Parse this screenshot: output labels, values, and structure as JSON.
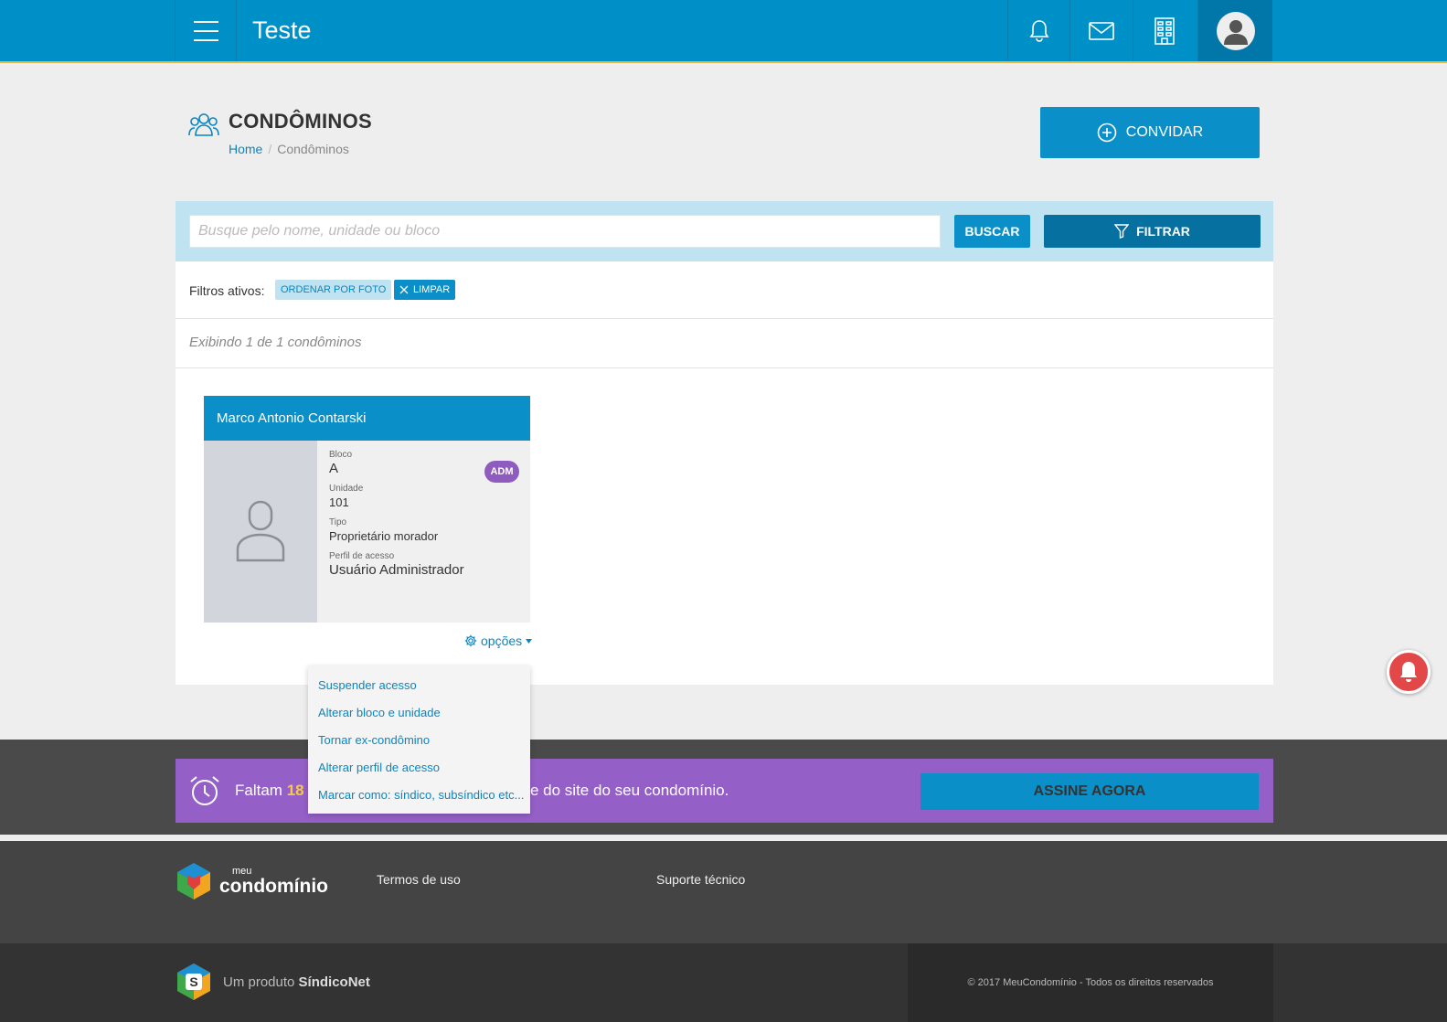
{
  "header": {
    "app_title": "Teste",
    "icons": [
      "menu-icon",
      "bell-icon",
      "mail-icon",
      "building-icon",
      "user-avatar-icon"
    ]
  },
  "page": {
    "title": "CONDÔMINOS",
    "breadcrumb": {
      "home": "Home",
      "separator": "/",
      "current": "Condôminos"
    },
    "invite_label": "CONVIDAR"
  },
  "search": {
    "placeholder": "Busque pelo nome, unidade ou bloco",
    "search_label": "BUSCAR",
    "filter_label": "FILTRAR"
  },
  "filters": {
    "label": "Filtros ativos:",
    "active_chip": "ORDENAR POR FOTO",
    "clear_label": "LIMPAR"
  },
  "results": {
    "count_text": "Exibindo 1 de 1 condôminos"
  },
  "card": {
    "name": "Marco Antonio Contarski",
    "badge": "ADM",
    "fields": {
      "bloco_label": "Bloco",
      "bloco_value": "A",
      "unidade_label": "Unidade",
      "unidade_value": "101",
      "tipo_label": "Tipo",
      "tipo_value": "Proprietário morador",
      "perfil_label": "Perfil de acesso",
      "perfil_value": "Usuário Administrador"
    },
    "options_label": "opções"
  },
  "dropdown": {
    "items": [
      "Suspender acesso",
      "Alterar bloco e unidade",
      "Tornar ex-condômino",
      "Alterar perfil de acesso",
      "Marcar como: síndico, subsíndico etc..."
    ]
  },
  "promo": {
    "text_start": "Faltam",
    "days": "18",
    "text_end": "e do site do seu condomínio.",
    "cta_label": "ASSINE AGORA"
  },
  "footer": {
    "brand_small": "meu",
    "brand_large": "condomínio",
    "links": [
      "Termos de uso",
      "Suporte técnico"
    ],
    "product_prefix": "Um produto",
    "product_name": "SíndicoNet",
    "copyright": "© 2017 MeuCondomínio - Todos os direitos reservados"
  },
  "colors": {
    "primary": "#0090c8",
    "primary_dark": "#0670a0",
    "accent_purple": "#9460c8",
    "badge_purple": "#8e5bbf",
    "alert_red": "#e34848"
  }
}
